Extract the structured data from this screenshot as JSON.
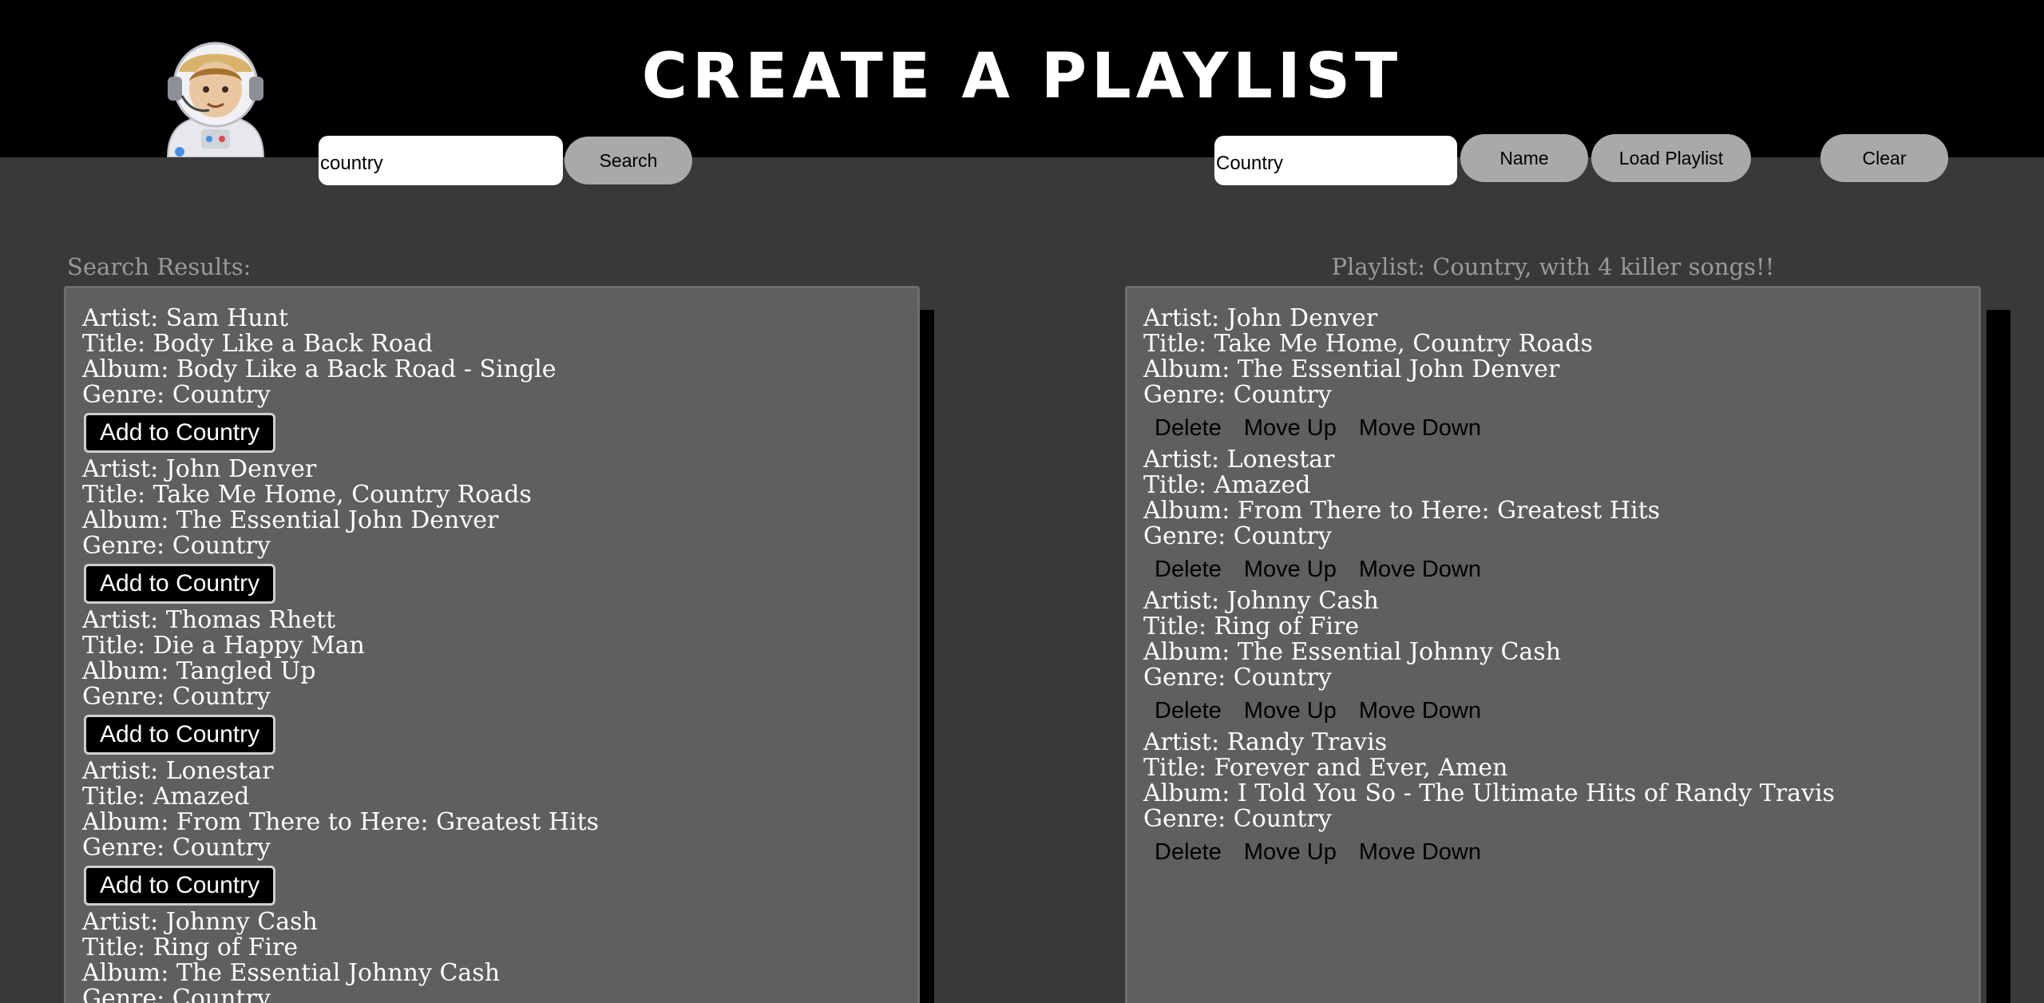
{
  "header": {
    "title": "Create a Playlist",
    "avatar_icon": "astronaut-icon"
  },
  "search": {
    "value": "country",
    "button_label": "Search"
  },
  "playlist_controls": {
    "name_value": "Country",
    "name_button_label": "Name",
    "load_button_label": "Load Playlist",
    "clear_button_label": "Clear"
  },
  "results": {
    "label": "Search Results:",
    "items": [
      {
        "artist": "Artist: Sam Hunt",
        "title": "Title: Body Like a Back Road",
        "album": "Album: Body Like a Back Road - Single",
        "genre": "Genre: Country",
        "add_label": "Add to Country"
      },
      {
        "artist": "Artist: John Denver",
        "title": "Title: Take Me Home, Country Roads",
        "album": "Album: The Essential John Denver",
        "genre": "Genre: Country",
        "add_label": "Add to Country"
      },
      {
        "artist": "Artist: Thomas Rhett",
        "title": "Title: Die a Happy Man",
        "album": "Album: Tangled Up",
        "genre": "Genre: Country",
        "add_label": "Add to Country"
      },
      {
        "artist": "Artist: Lonestar",
        "title": "Title: Amazed",
        "album": "Album: From There to Here: Greatest Hits",
        "genre": "Genre: Country",
        "add_label": "Add to Country"
      },
      {
        "artist": "Artist: Johnny Cash",
        "title": "Title: Ring of Fire",
        "album": "Album: The Essential Johnny Cash",
        "genre": "Genre: Country"
      }
    ]
  },
  "playlist": {
    "label": "Playlist: Country, with 4 killer songs!!",
    "delete_label": "Delete",
    "move_up_label": "Move Up",
    "move_down_label": "Move Down",
    "items": [
      {
        "artist": "Artist: John Denver",
        "title": "Title: Take Me Home, Country Roads",
        "album": "Album: The Essential John Denver",
        "genre": "Genre: Country"
      },
      {
        "artist": "Artist: Lonestar",
        "title": "Title: Amazed",
        "album": "Album: From There to Here: Greatest Hits",
        "genre": "Genre: Country"
      },
      {
        "artist": "Artist: Johnny Cash",
        "title": "Title: Ring of Fire",
        "album": "Album: The Essential Johnny Cash",
        "genre": "Genre: Country"
      },
      {
        "artist": "Artist: Randy Travis",
        "title": "Title: Forever and Ever, Amen",
        "album": "Album: I Told You So - The Ultimate Hits of Randy Travis",
        "genre": "Genre: Country"
      }
    ]
  }
}
